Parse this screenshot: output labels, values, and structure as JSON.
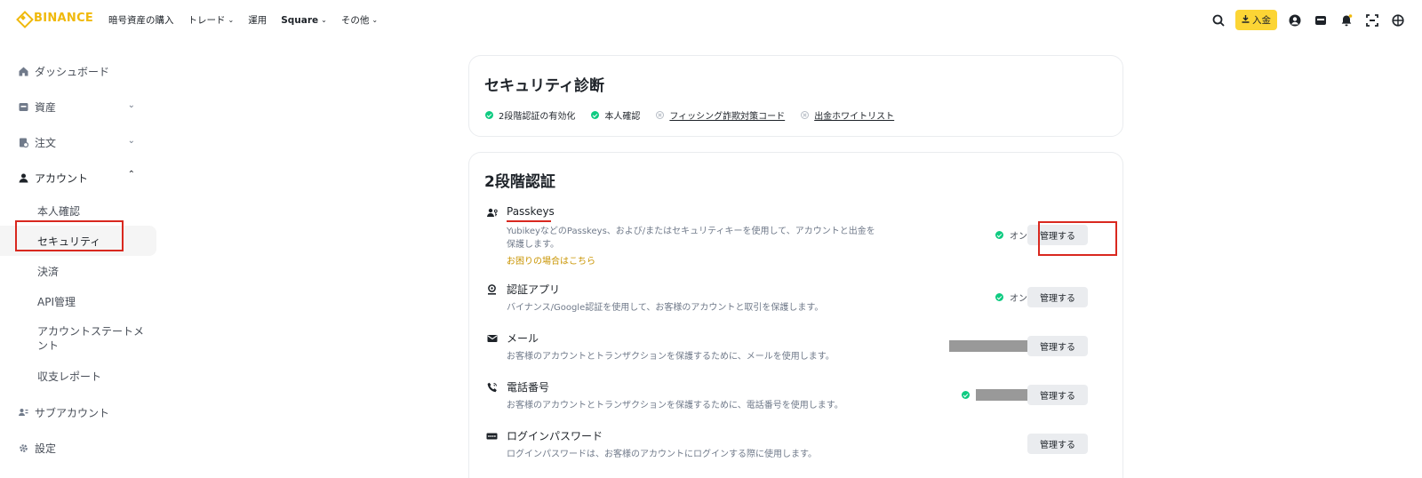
{
  "header": {
    "brand": "BINANCE",
    "nav": [
      {
        "label": "暗号資産の購入",
        "dropdown": false
      },
      {
        "label": "トレード",
        "dropdown": true
      },
      {
        "label": "運用",
        "dropdown": false
      },
      {
        "label": "Square",
        "dropdown": true
      },
      {
        "label": "その他",
        "dropdown": true
      }
    ],
    "deposit_label": "入金",
    "accent_color": "#fcd535"
  },
  "sidebar": {
    "items": [
      {
        "label": "ダッシュボード",
        "icon": "home-icon"
      },
      {
        "label": "資産",
        "icon": "wallet-icon",
        "caret": "down"
      },
      {
        "label": "注文",
        "icon": "orders-icon",
        "caret": "down"
      },
      {
        "label": "アカウント",
        "icon": "user-icon",
        "caret": "up"
      }
    ],
    "account_sub": [
      {
        "label": "本人確認"
      },
      {
        "label": "セキュリティ",
        "active": true
      },
      {
        "label": "決済"
      },
      {
        "label": "API管理"
      },
      {
        "label": "アカウントステートメント"
      },
      {
        "label": "収支レポート"
      }
    ],
    "bottom_items": [
      {
        "label": "サブアカウント",
        "icon": "sub-account-icon"
      },
      {
        "label": "設定",
        "icon": "settings-icon"
      }
    ]
  },
  "security_diagnosis": {
    "title": "セキュリティ診断",
    "items": [
      {
        "label": "2段階認証の有効化",
        "status": "ok"
      },
      {
        "label": "本人確認",
        "status": "ok"
      },
      {
        "label": "フィッシング詐欺対策コード",
        "status": "off"
      },
      {
        "label": "出金ホワイトリスト",
        "status": "off"
      }
    ]
  },
  "two_factor": {
    "title": "2段階認証",
    "manage_label": "管理する",
    "rows": [
      {
        "title": "Passkeys",
        "desc": "YubikeyなどのPasskeys、および/またはセキュリティキーを使用して、アカウントと出金を保護します。",
        "help": "お困りの場合はこちら",
        "status": "オン",
        "icon": "passkey-icon"
      },
      {
        "title": "認証アプリ",
        "desc": "バイナンス/Google認証を使用して、お客様のアカウントと取引を保護します。",
        "status": "オン",
        "icon": "authenticator-icon"
      },
      {
        "title": "メール",
        "desc": "お客様のアカウントとトランザクションを保護するために、メールを使用します。",
        "icon": "mail-icon"
      },
      {
        "title": "電話番号",
        "desc": "お客様のアカウントとトランザクションを保護するために、電話番号を使用します。",
        "icon": "phone-icon"
      },
      {
        "title": "ログインパスワード",
        "desc": "ログインパスワードは、お客様のアカウントにログインする際に使用します。",
        "icon": "password-icon"
      }
    ]
  }
}
